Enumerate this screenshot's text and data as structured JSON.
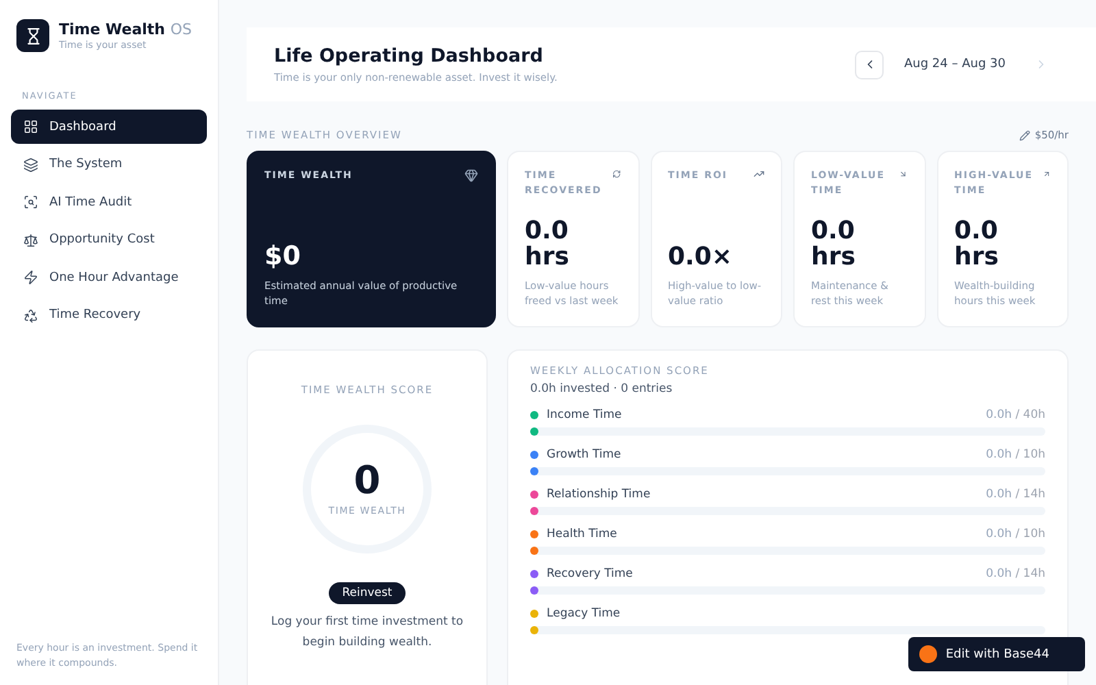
{
  "brand": {
    "name": "Time Wealth",
    "suffix": "OS",
    "tagline": "Time is your asset"
  },
  "sidebar": {
    "section": "NAVIGATE",
    "items": [
      {
        "label": "Dashboard",
        "selected": true
      },
      {
        "label": "The System",
        "selected": false
      },
      {
        "label": "AI Time Audit",
        "selected": false
      },
      {
        "label": "Opportunity Cost",
        "selected": false
      },
      {
        "label": "One Hour Advantage",
        "selected": false
      },
      {
        "label": "Time Recovery",
        "selected": false
      }
    ],
    "footer": "Every hour is an investment. Spend it where it compounds."
  },
  "header": {
    "title": "Life Operating Dashboard",
    "subtitle": "Time is your only non-renewable asset. Invest it wisely.",
    "date_range": "Aug 24 – Aug 30"
  },
  "overview": {
    "title": "TIME WEALTH OVERVIEW",
    "rate": "$50/hr",
    "cards": [
      {
        "kind": "hero",
        "title": "TIME WEALTH",
        "value": "$0",
        "note": "Estimated annual value of productive time"
      },
      {
        "kind": "stat",
        "title": "TIME RECOVERED",
        "value": "0.0 hrs",
        "note": "Low-value hours freed vs last week"
      },
      {
        "kind": "stat",
        "title": "TIME ROI",
        "value": "0.0×",
        "note": "High-value to low-value ratio"
      },
      {
        "kind": "stat",
        "title": "LOW-VALUE TIME",
        "value": "0.0 hrs",
        "note": "Maintenance & rest this week"
      },
      {
        "kind": "stat",
        "title": "HIGH-VALUE TIME",
        "value": "0.0 hrs",
        "note": "Wealth-building hours this week"
      }
    ]
  },
  "score": {
    "title": "TIME WEALTH SCORE",
    "value": "0",
    "label": "TIME WEALTH",
    "level": 0,
    "button": "Reinvest",
    "message": "Log your first time investment to begin building wealth."
  },
  "allocation": {
    "title": "WEEKLY ALLOCATION SCORE",
    "summary": "0.0h invested · 0 entries",
    "rows": [
      {
        "name": "Income Time",
        "color": "#10b981",
        "hours": "0.0h",
        "target": "/ 40h",
        "level": 0
      },
      {
        "name": "Growth Time",
        "color": "#3b82f6",
        "hours": "0.0h",
        "target": "/ 10h",
        "level": 0
      },
      {
        "name": "Relationship Time",
        "color": "#ec4899",
        "hours": "0.0h",
        "target": "/ 14h",
        "level": 0
      },
      {
        "name": "Health Time",
        "color": "#f97316",
        "hours": "0.0h",
        "target": "/ 10h",
        "level": 0
      },
      {
        "name": "Recovery Time",
        "color": "#8b5cf6",
        "hours": "0.0h",
        "target": "/ 14h",
        "level": 0
      },
      {
        "name": "Legacy Time",
        "color": "#eab308",
        "level": 0
      }
    ]
  },
  "badge": {
    "label": "Edit with Base44"
  }
}
